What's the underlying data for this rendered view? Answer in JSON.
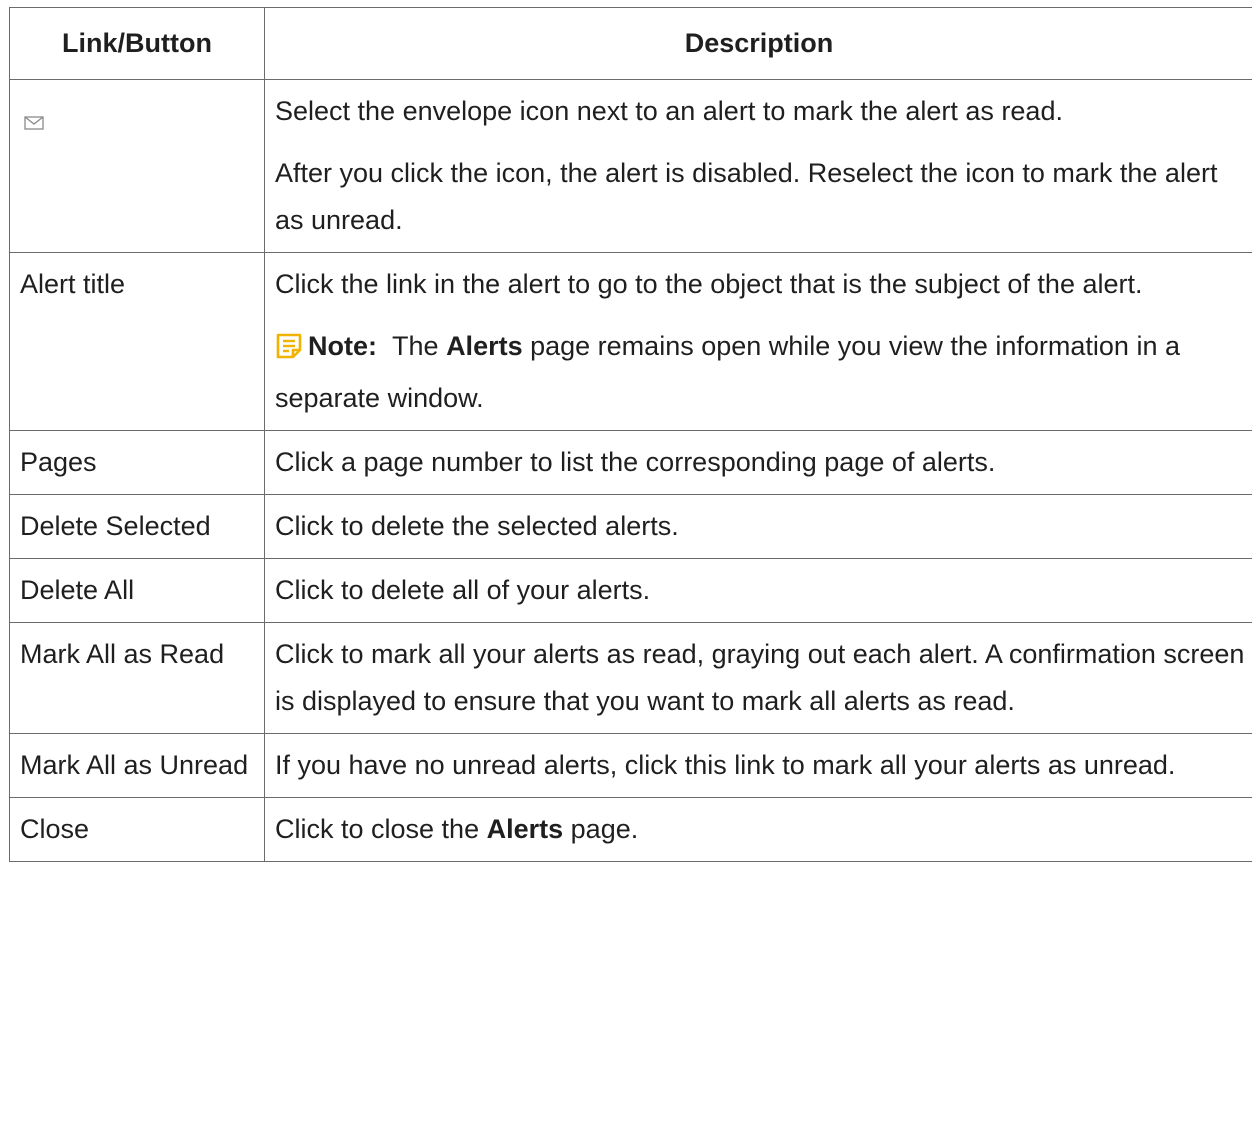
{
  "table": {
    "headers": {
      "link": "Link/Button",
      "description": "Description"
    },
    "rows": [
      {
        "link_icon": "envelope-icon",
        "paragraphs": [
          "Select the envelope icon next to an alert to mark the alert as read.",
          "After you click the icon, the alert is disabled. Reselect the icon to mark the alert as unread."
        ]
      },
      {
        "link": "Alert title",
        "paragraph": "Click the link in the alert to go to the object that is the subject of the alert.",
        "note": {
          "icon": "note-icon",
          "label": "Note:",
          "pre": "The",
          "bold": "Alerts",
          "post": "page remains open while you view the information in a separate window."
        }
      },
      {
        "link": "Pages",
        "paragraph": "Click a page number to list the corresponding page of alerts."
      },
      {
        "link": "Delete Selected",
        "paragraph": "Click to delete the selected alerts."
      },
      {
        "link": "Delete All",
        "paragraph": "Click to delete all of your alerts."
      },
      {
        "link": "Mark All as Read",
        "paragraph": "Click to mark all your alerts as read, graying out each alert. A confirmation screen is displayed to ensure that you want to mark all alerts as read."
      },
      {
        "link": "Mark All as Unread",
        "paragraph": "If you have no unread alerts, click this link to mark all your alerts as unread."
      },
      {
        "link": "Close",
        "pre": "Click to close the",
        "bold": "Alerts",
        "post": "page."
      }
    ]
  },
  "colors": {
    "text": "#1f1f1f",
    "border": "#6b6b6b",
    "note_icon": "#f0b400"
  }
}
